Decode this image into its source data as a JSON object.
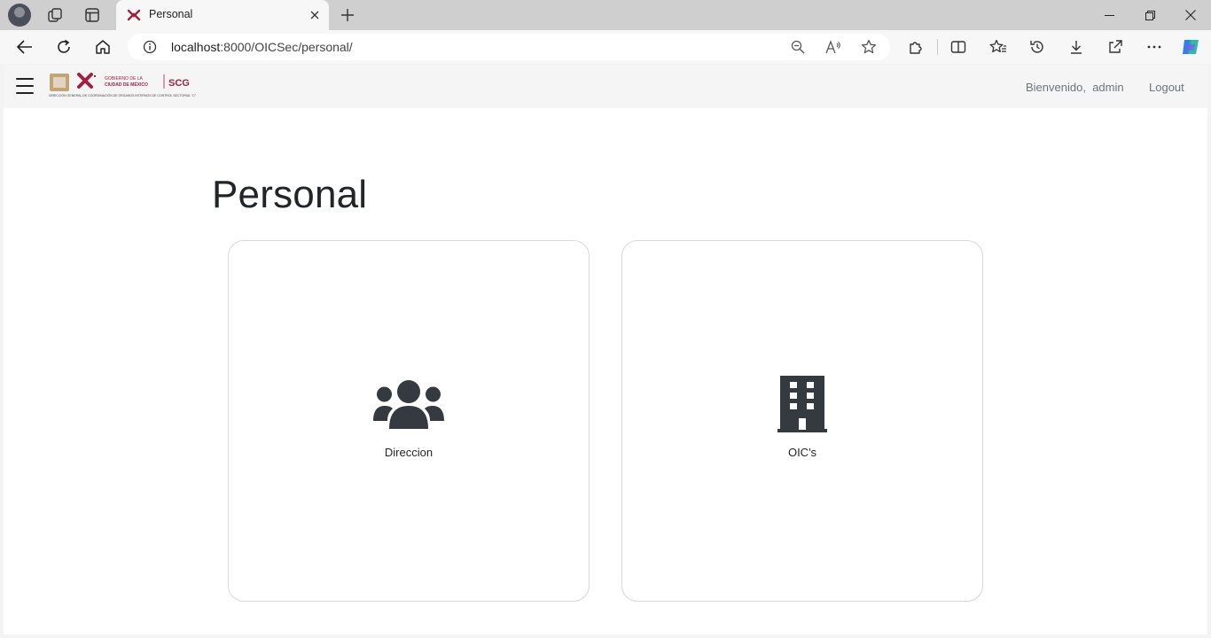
{
  "browser": {
    "tab": {
      "title": "Personal"
    },
    "address": {
      "host": "localhost",
      "rest": ":8000/OICSec/personal/"
    }
  },
  "navbar": {
    "logo_top_text": "GOBIERNO DE LA",
    "logo_mid_text": "CIUDAD DE MÉXICO",
    "logo_acronym": "SCG",
    "logo_subtitle": "DIRECCIÓN GENERAL DE COORDINACIÓN DE ÓRGANOS INTERNOS DE CONTROL SECTORIAL \"C\"",
    "welcome": "Bienvenido,",
    "user": "admin",
    "logout_label": "Logout"
  },
  "main": {
    "title": "Personal",
    "cards": [
      {
        "label": "Direccion",
        "icon": "users-icon"
      },
      {
        "label": "OIC's",
        "icon": "building-icon"
      }
    ]
  },
  "colors": {
    "brand": "#9f2241",
    "accent_gold": "#bc955c",
    "icon_dark": "#343a40"
  }
}
